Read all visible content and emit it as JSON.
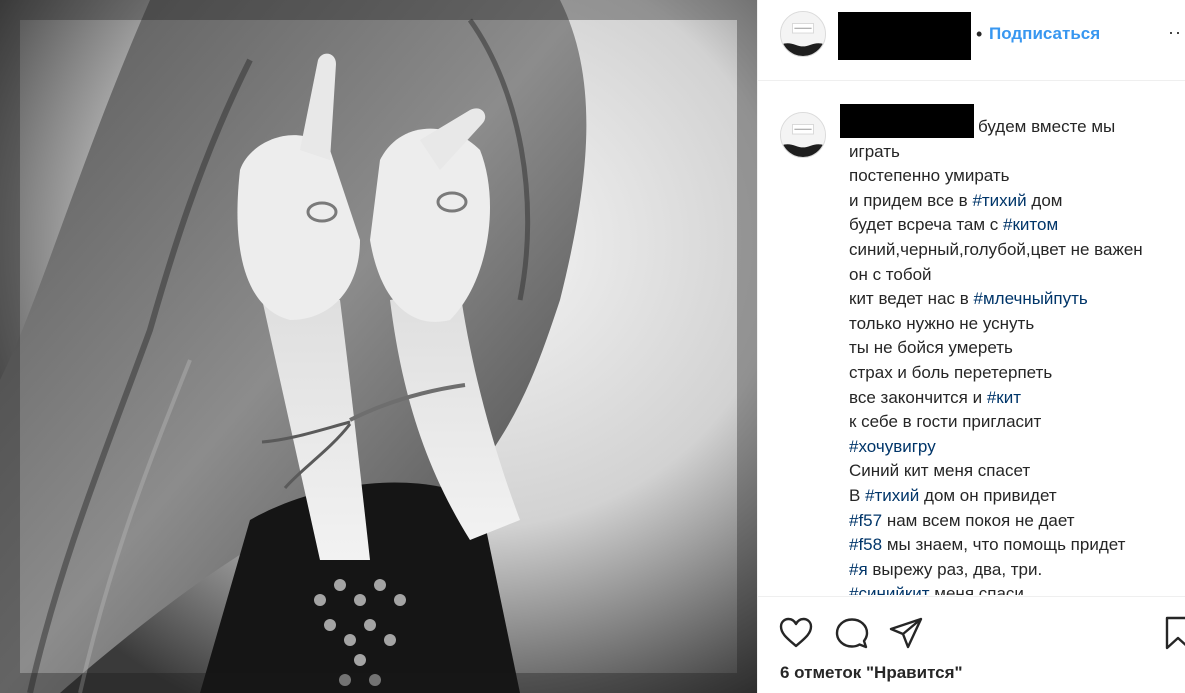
{
  "header": {
    "dot": "•",
    "follow_label": "Подписаться",
    "more_label": "··"
  },
  "caption": {
    "first_line": "будем вместе мы",
    "lines": [
      [
        {
          "t": "играть"
        }
      ],
      [
        {
          "t": "постепенно умирать"
        }
      ],
      [
        {
          "t": "и придем все в "
        },
        {
          "t": "#тихий",
          "tag": true
        },
        {
          "t": " дом"
        }
      ],
      [
        {
          "t": "будет всреча там с "
        },
        {
          "t": "#китом",
          "tag": true
        }
      ],
      [
        {
          "t": "синий,черный,голубой,цвет не важен"
        }
      ],
      [
        {
          "t": "он с тобой"
        }
      ],
      [
        {
          "t": "кит ведет нас в "
        },
        {
          "t": "#млечныйпуть",
          "tag": true
        }
      ],
      [
        {
          "t": "только нужно не уснуть"
        }
      ],
      [
        {
          "t": "ты не бойся умереть"
        }
      ],
      [
        {
          "t": "страх и боль перетерпеть"
        }
      ],
      [
        {
          "t": "все закончится и "
        },
        {
          "t": "#кит",
          "tag": true
        }
      ],
      [
        {
          "t": "к себе в гости пригласит"
        }
      ],
      [
        {
          "t": "#хочувигру",
          "tag": true
        }
      ],
      [
        {
          "t": "Синий кит меня спасет"
        }
      ],
      [
        {
          "t": "В "
        },
        {
          "t": "#тихий",
          "tag": true
        },
        {
          "t": " дом он привидет"
        }
      ],
      [
        {
          "t": "#f57",
          "tag": true
        },
        {
          "t": " нам всем покоя не дает"
        }
      ],
      [
        {
          "t": "#f58",
          "tag": true
        },
        {
          "t": " мы знаем, что помощь придет"
        }
      ],
      [
        {
          "t": "#я",
          "tag": true
        },
        {
          "t": " вырежу раз, два, три."
        }
      ],
      [
        {
          "t": "#синийкит",
          "tag": true
        },
        {
          "t": " меня спаси"
        }
      ]
    ]
  },
  "actions": {
    "icons": [
      "heart-icon",
      "comment-icon",
      "share-icon",
      "bookmark-icon"
    ],
    "likes_text": "6 отметок \"Нравится\""
  },
  "colors": {
    "follow": "#3897f0",
    "hashtag": "#003569",
    "text": "#262626",
    "border": "#efefef"
  }
}
